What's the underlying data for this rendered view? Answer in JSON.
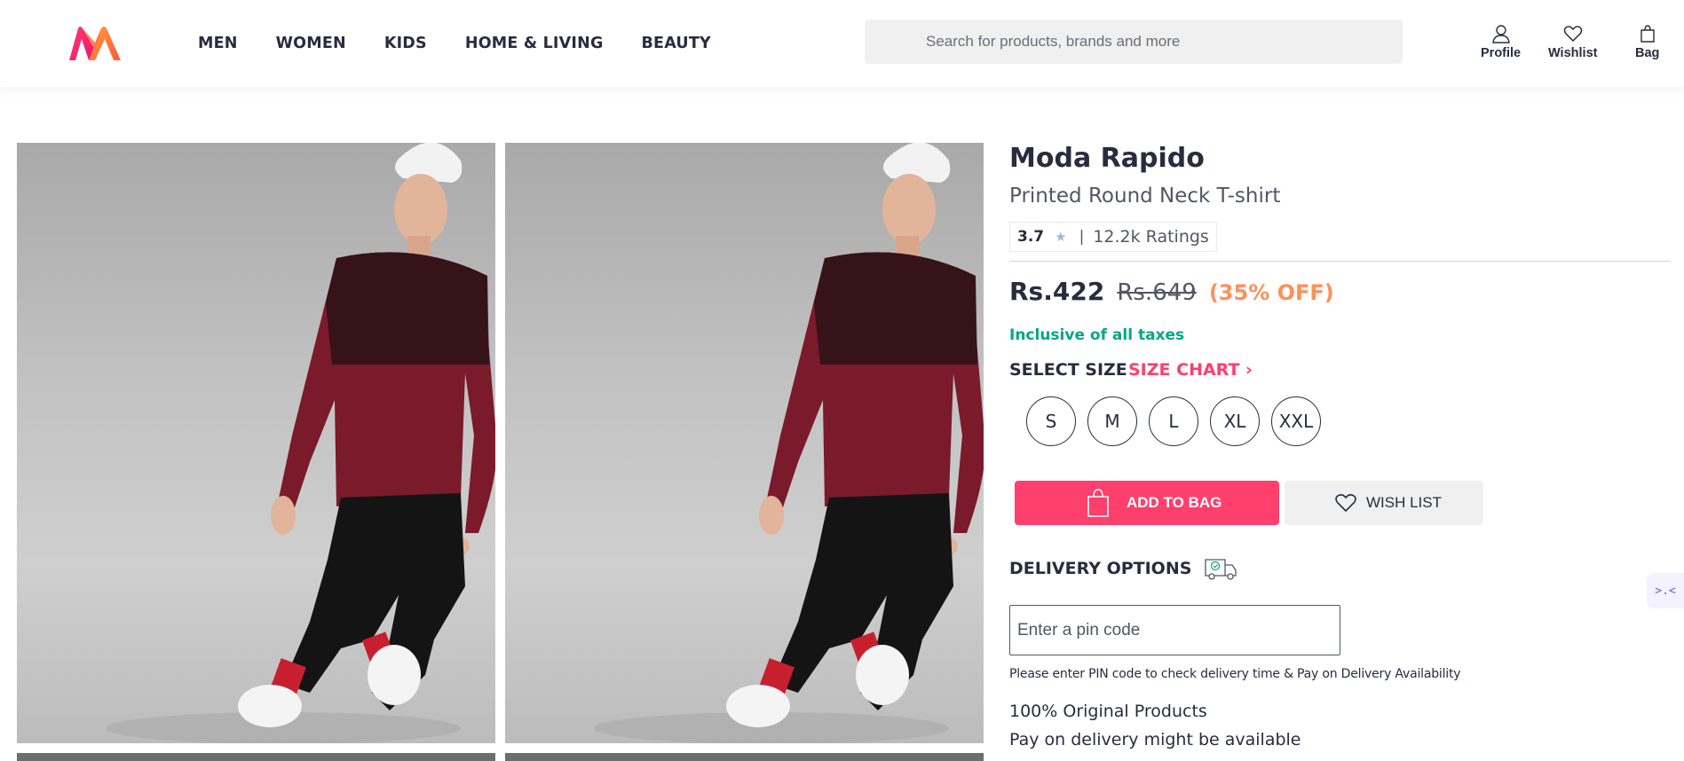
{
  "header": {
    "nav": [
      "MEN",
      "WOMEN",
      "KIDS",
      "HOME & LIVING",
      "BEAUTY"
    ],
    "search_placeholder": "Search for products, brands and more",
    "actions": {
      "profile": "Profile",
      "wishlist": "Wishlist",
      "bag": "Bag"
    }
  },
  "product": {
    "brand": "Moda Rapido",
    "name": "Printed Round Neck T-shirt",
    "rating": "3.7",
    "rating_count": "12.2k Ratings",
    "price": "Rs.422",
    "mrp": "Rs.649",
    "discount": "(35% OFF)",
    "tax_note": "Inclusive of all taxes"
  },
  "size": {
    "title": "SELECT SIZE",
    "chart_link": "SIZE CHART",
    "options": [
      "S",
      "M",
      "L",
      "XL",
      "XXL"
    ]
  },
  "actions": {
    "add_to_bag": "ADD TO BAG",
    "wishlist": "WISH LIST"
  },
  "delivery": {
    "title": "DELIVERY OPTIONS",
    "pin_placeholder": "Enter a pin code",
    "pin_note": "Please enter PIN code to check delivery time & Pay on Delivery Availability",
    "features": [
      "100% Original Products",
      "Pay on delivery might be available"
    ]
  },
  "colors": {
    "accent": "#ff3f6c",
    "discount": "#ff905a",
    "tax": "#03a685",
    "text": "#282c3f",
    "shirt": "#7a1a2b",
    "sock": "#c81f2e"
  }
}
